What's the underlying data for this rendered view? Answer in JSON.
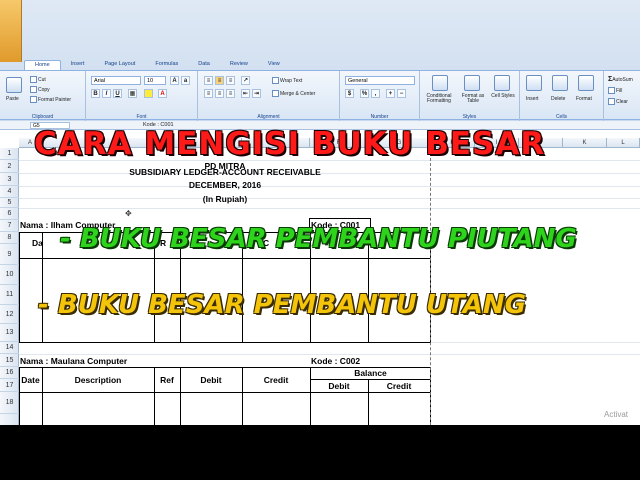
{
  "ribbon": {
    "tabs": [
      "Home",
      "Insert",
      "Page Layout",
      "Formulas",
      "Data",
      "Review",
      "View"
    ],
    "active_tab": "Home",
    "clipboard": {
      "paste": "Paste",
      "cut": "Cut",
      "copy": "Copy",
      "format_painter": "Format Painter",
      "label": "Clipboard"
    },
    "font": {
      "name": "Arial",
      "size": "10",
      "label": "Font"
    },
    "alignment": {
      "wrap": "Wrap Text",
      "merge": "Merge & Center",
      "label": "Alignment"
    },
    "number": {
      "format": "General",
      "label": "Number"
    },
    "styles": {
      "conditional": "Conditional Formatting",
      "format_table": "Format as Table",
      "cell_styles": "Cell Styles",
      "label": "Styles"
    },
    "cells": {
      "insert": "Insert",
      "delete": "Delete",
      "format": "Format",
      "label": "Cells"
    },
    "editing": {
      "autosum": "AutoSum",
      "fill": "Fill",
      "clear": "Clear"
    }
  },
  "formula_bar": {
    "name_box": "G5",
    "formula": "Kode : C001"
  },
  "columns": [
    "A",
    "B",
    "C",
    "D",
    "E",
    "F",
    "G",
    "H",
    "I",
    "J",
    "K",
    "L"
  ],
  "rows": [
    "1",
    "2",
    "3",
    "4",
    "5",
    "6",
    "7",
    "8",
    "9",
    "10",
    "11",
    "12",
    "13",
    "14",
    "15",
    "16",
    "17",
    "18"
  ],
  "sheet": {
    "company": "PD MITRA",
    "ledger_title": "SUBSIDIARY LEDGER-ACCOUNT RECEIVABLE",
    "period": "DECEMBER, 2016",
    "currency": "(In Rupiah)",
    "customer1_name": "Nama : Ilham Computer",
    "customer1_code": "Kode : C001",
    "customer2_name": "Nama : Maulana Computer",
    "customer2_code": "Kode : C002",
    "headers": {
      "date": "Date",
      "description": "Description",
      "ref": "Ref",
      "debit": "Debit",
      "credit": "Credit",
      "balance": "Balance",
      "balance_debit": "Debit",
      "balance_credit": "Credit"
    },
    "partial_headers": {
      "date": "Da",
      "ref": "R",
      "credit": "C"
    }
  },
  "overlays": {
    "title": "CARA MENGISI BUKU BESAR",
    "line1": "- BUKU BESAR PEMBANTU PIUTANG",
    "line2": "- BUKU BESAR PEMBANTU UTANG"
  },
  "watermark": "Activat",
  "colors": {
    "title": "#ff1a1a",
    "line1": "#2ed41c",
    "line2": "#f4c40a"
  }
}
